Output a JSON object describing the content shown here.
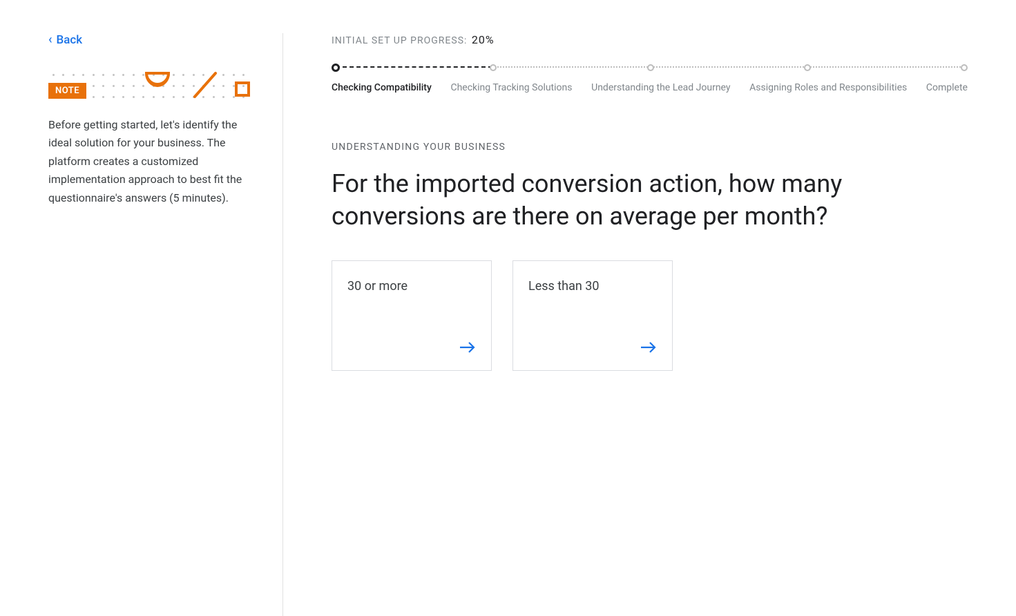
{
  "back_label": "Back",
  "note_badge": "NOTE",
  "note_text": "Before getting started, let's identify the ideal solution for your business. The platform creates a customized implementation approach to best fit the questionnaire's answers (5 minutes).",
  "progress": {
    "label_prefix": "INITIAL SET UP PROGRESS:",
    "percent": "20%"
  },
  "steps": [
    {
      "label": "Checking Compatibility",
      "active": true
    },
    {
      "label": "Checking Tracking Solutions",
      "active": false
    },
    {
      "label": "Understanding the Lead Journey",
      "active": false
    },
    {
      "label": "Assigning Roles and Responsibilities",
      "active": false
    },
    {
      "label": "Complete",
      "active": false
    }
  ],
  "eyebrow": "UNDERSTANDING YOUR BUSINESS",
  "question": "For the imported conversion action, how many conversions are there on average per month?",
  "options": [
    {
      "label": "30 or more"
    },
    {
      "label": "Less than 30"
    }
  ],
  "colors": {
    "primary_blue": "#1a73e8",
    "accent_orange": "#e8710a"
  }
}
